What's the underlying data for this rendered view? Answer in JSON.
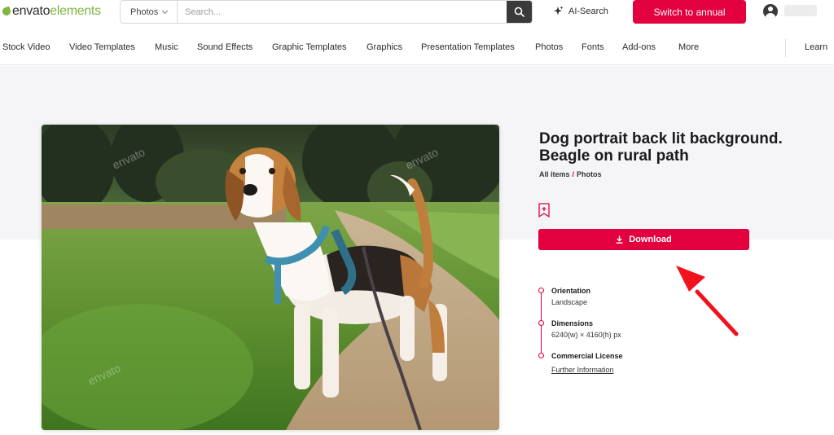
{
  "header": {
    "logo": {
      "part1": "envato",
      "part2": "elements"
    },
    "search": {
      "category": "Photos",
      "placeholder": "Search..."
    },
    "ai_search_label": "AI-Search",
    "switch_label": "Switch to annual"
  },
  "nav": {
    "items": [
      "Stock Video",
      "Video Templates",
      "Music",
      "Sound Effects",
      "Graphic Templates",
      "Graphics",
      "Presentation Templates",
      "Photos",
      "Fonts",
      "Add-ons",
      "More"
    ],
    "learn": "Learn"
  },
  "item": {
    "title": "Dog portrait back lit background. Beagle on rural path",
    "breadcrumb": {
      "all": "All items",
      "sep": "/",
      "current": "Photos"
    },
    "download_label": "Download",
    "specs": {
      "orientation_label": "Orientation",
      "orientation_value": "Landscape",
      "dimensions_label": "Dimensions",
      "dimensions_value": "6240(w) × 4160(h) px",
      "license_label": "Commercial License",
      "license_link": "Further Information"
    },
    "watermark": "envato"
  },
  "colors": {
    "accent": "#e2003f",
    "brand_green": "#82b541",
    "dark_button": "#3a3a3a"
  }
}
